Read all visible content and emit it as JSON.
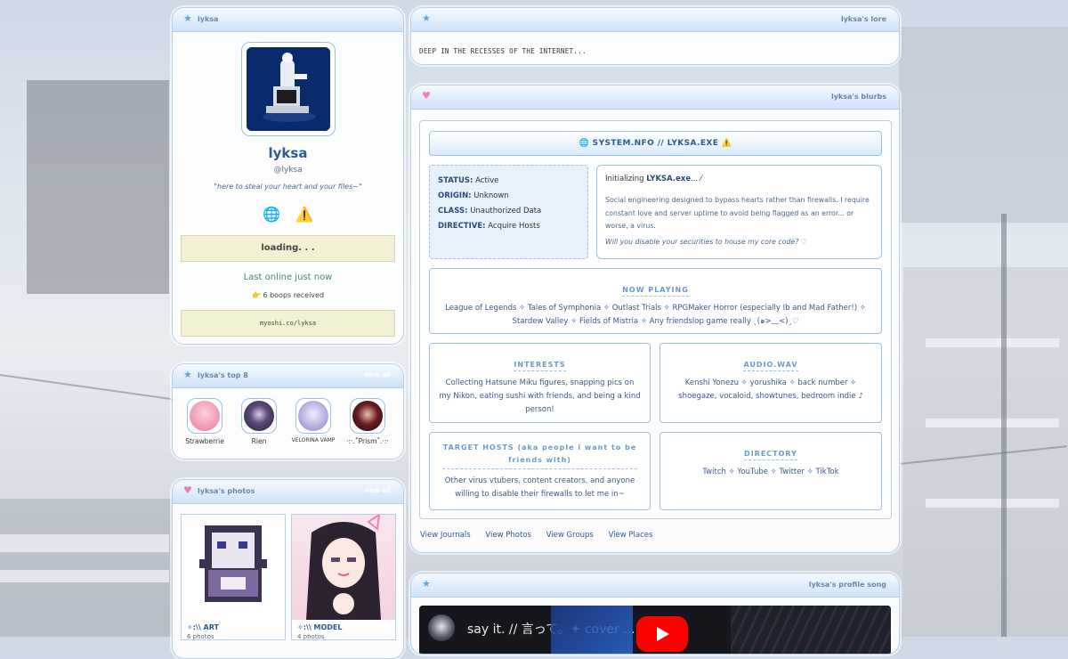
{
  "colors": {
    "accent": "#2c5a95",
    "panel_border": "#b9cfe8",
    "header_blue": "#cfe3f8",
    "highlight_yellow": "#f3f1d3",
    "star": "#56a7e8",
    "heart": "#f27eb6"
  },
  "profile": {
    "header_name": "lyksa",
    "name": "lyksa",
    "handle": "@lyksa",
    "quote": "\"here to steal your heart and your files~\"",
    "icons": [
      "globe-icon",
      "warning-icon"
    ],
    "status_box": "loading. . .",
    "last_online": "Last online just now",
    "boops": "👉 6 boops received",
    "url": "myoshi.co/lyksa"
  },
  "top8": {
    "title": "lyksa's top 8",
    "view_all": "view all",
    "friends": [
      {
        "name": "Strawberrie",
        "color": "#f0a0b8"
      },
      {
        "name": "Rien",
        "color": "#3a2e4e"
      },
      {
        "name": "VELORINA VAMP",
        "color": "#b8b0e0"
      },
      {
        "name": "·:·.˚Prism˚.·:·",
        "color": "#3a1e22"
      }
    ]
  },
  "photos": {
    "title": "lyksa's photos",
    "view_all": "view all",
    "albums": [
      {
        "label": "✧:\\\\ ART",
        "count": "6 photos"
      },
      {
        "label": "✧:\\\\ MODEL",
        "count": "4 photos"
      }
    ]
  },
  "lore": {
    "title": "lyksa's lore",
    "text": "DEEP IN THE RECESSES OF THE INTERNET..."
  },
  "blurbs": {
    "title": "lyksa's blurbs",
    "system_header": "🌐 SYSTEM.NFO // LYKSA.EXE ⚠️",
    "status": [
      {
        "key": "STATUS:",
        "value": "Active"
      },
      {
        "key": "ORIGIN:",
        "value": "Unknown"
      },
      {
        "key": "CLASS:",
        "value": "Unauthorized Data"
      },
      {
        "key": "DIRECTIVE:",
        "value": "Acquire Hosts"
      }
    ],
    "init_prefix": "Initializing ",
    "init_name": "LYKSA.exe",
    "init_suffix": "... ⁄",
    "init_body": "Social engineering designed to bypass hearts rather than firewalls. I require constant love and server uptime to avoid being flagged as an error... or worse, a virus.",
    "init_question": "Will you disable your securities to house my core code? ♡",
    "now_playing": {
      "title": "NOW PLAYING",
      "body": "League of Legends ✧ Tales of Symphonia ✧ Outlast Trials ✧ RPGMaker Horror (especially Ib and Mad Father!) ✧ Stardew Valley ✧ Fields of Mistria ✧ Any friendslop game really ˎ(๑>﹏<)ˏ♡"
    },
    "interests": {
      "title": "INTERESTS",
      "body": "Collecting Hatsune Miku figures, snapping pics on my Nikon, eating sushi with friends, and being a kind person!"
    },
    "audio": {
      "title": "AUDIO.WAV",
      "body": "Kenshi Yonezu ✧ yorushika ✧ back number ✧ shoegaze, vocaloid, showtunes, bedroom indie ♪"
    },
    "targets": {
      "title": "TARGET HOSTS (aka people i want to be friends with)",
      "body": "Other virus vtubers, content creators, and anyone willing to disable their firewalls to let me in~"
    },
    "directory": {
      "title": "DIRECTORY",
      "body": "Twitch ✧ YouTube ✧ Twitter ✧ TikTok"
    },
    "links": [
      "View Journals",
      "View Photos",
      "View Groups",
      "View Places"
    ]
  },
  "song": {
    "title": "lyksa's profile song",
    "video_title": "say it. // 言って。✦ cover ... EXE"
  }
}
